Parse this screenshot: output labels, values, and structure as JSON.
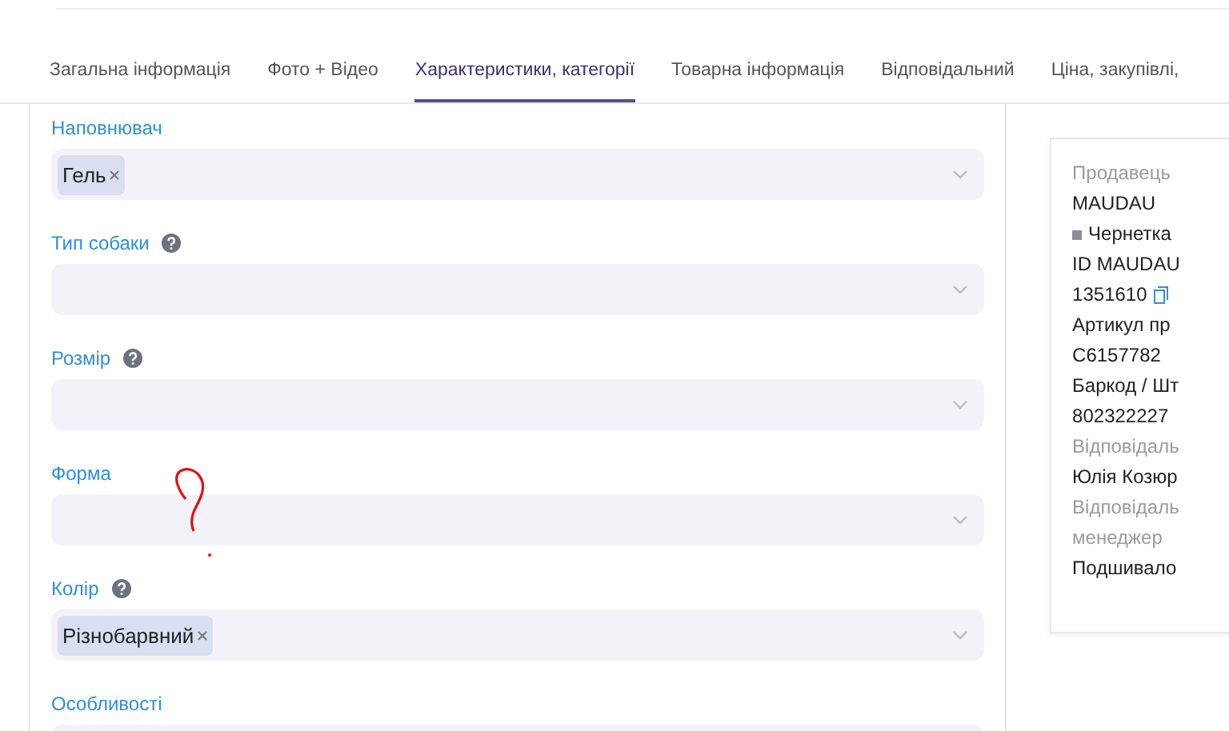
{
  "tabs": [
    {
      "label": "Загальна інформація",
      "selected": false
    },
    {
      "label": "Фото + Відео",
      "selected": false
    },
    {
      "label": "Характеристики, категорії",
      "selected": true
    },
    {
      "label": "Товарна інформація",
      "selected": false
    },
    {
      "label": "Відповідальний",
      "selected": false
    },
    {
      "label": "Ціна, закупівлі,",
      "selected": false
    }
  ],
  "fields": [
    {
      "label": "Наповнювач",
      "help": false,
      "tags": [
        "Гель"
      ]
    },
    {
      "label": "Тип собаки",
      "help": true
    },
    {
      "label": "Розмір",
      "help": true
    },
    {
      "label": "Форма",
      "help": false
    },
    {
      "label": "Колір",
      "help": true,
      "tags": [
        "Різнобарвний"
      ]
    },
    {
      "label": "Особливості",
      "help": false
    }
  ],
  "seller_card": [
    {
      "kind": "caption",
      "text": "Продавець"
    },
    {
      "kind": "value",
      "text": "MAUDAU"
    },
    {
      "kind": "status",
      "text": "Чернетка"
    },
    {
      "kind": "value",
      "text": "ID MAUDAU"
    },
    {
      "kind": "copyable",
      "text": "1351610"
    },
    {
      "kind": "value",
      "text": "Артикул пр"
    },
    {
      "kind": "value",
      "text": "C6157782"
    },
    {
      "kind": "value",
      "text": "Баркод / Шт"
    },
    {
      "kind": "value",
      "text": "802322227"
    },
    {
      "kind": "caption",
      "text": "Відповідаль"
    },
    {
      "kind": "value",
      "text": "Юлія Козюр"
    },
    {
      "kind": "caption",
      "text": "Відповідаль"
    },
    {
      "kind": "caption",
      "text": "менеджер"
    },
    {
      "kind": "value",
      "text": "Подшивало"
    }
  ]
}
